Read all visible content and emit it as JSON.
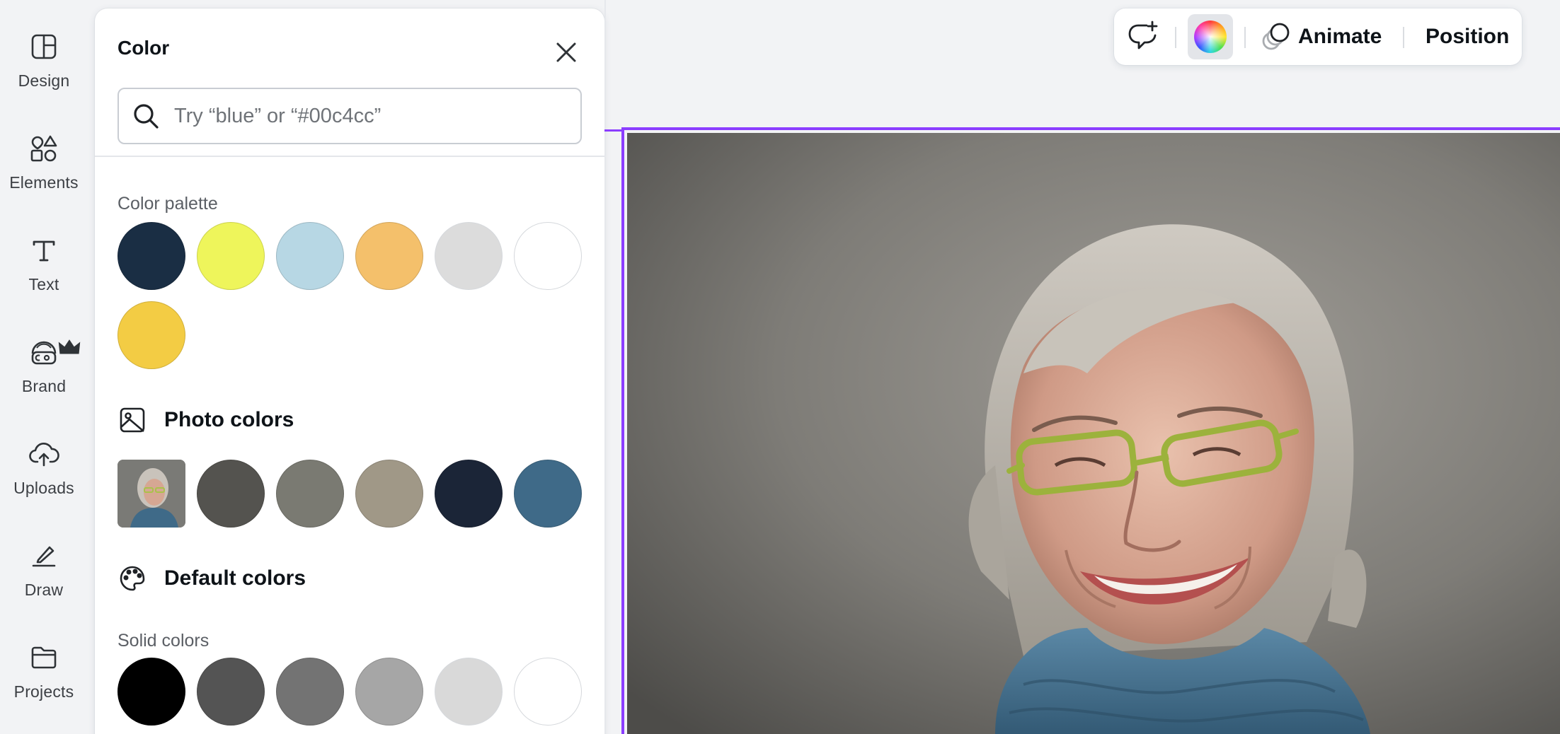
{
  "sidebar": {
    "items": [
      {
        "label": "Design",
        "icon": "design-icon"
      },
      {
        "label": "Elements",
        "icon": "elements-icon"
      },
      {
        "label": "Text",
        "icon": "text-icon"
      },
      {
        "label": "Brand",
        "icon": "brand-icon",
        "badge": "crown-icon"
      },
      {
        "label": "Uploads",
        "icon": "uploads-icon"
      },
      {
        "label": "Draw",
        "icon": "draw-icon"
      },
      {
        "label": "Projects",
        "icon": "projects-icon"
      }
    ]
  },
  "color_panel": {
    "title": "Color",
    "search": {
      "placeholder": "Try “blue” or “#00c4cc”",
      "value": ""
    },
    "palette": {
      "label": "Color palette",
      "colors": [
        "#1a2e44",
        "#eef55b",
        "#b7d7e4",
        "#f4c06b",
        "#dcdcdc",
        "#ffffff",
        "#f3cc44"
      ]
    },
    "photo_colors": {
      "heading": "Photo colors",
      "colors": [
        "#54534f",
        "#7a7a72",
        "#a09887",
        "#1b2537",
        "#3f6a88"
      ]
    },
    "default_colors": {
      "heading": "Default colors",
      "solid_label": "Solid colors",
      "colors": [
        "#000000",
        "#545454",
        "#737373",
        "#a6a6a6",
        "#d9d9d9",
        "#ffffff"
      ]
    }
  },
  "toolbar": {
    "comment_icon": "add-comment-icon",
    "color_icon": "color-wheel-icon",
    "animate_label": "Animate",
    "position_label": "Position"
  },
  "canvas": {
    "selected_element": "photo",
    "selection_color": "#8b3dff"
  }
}
